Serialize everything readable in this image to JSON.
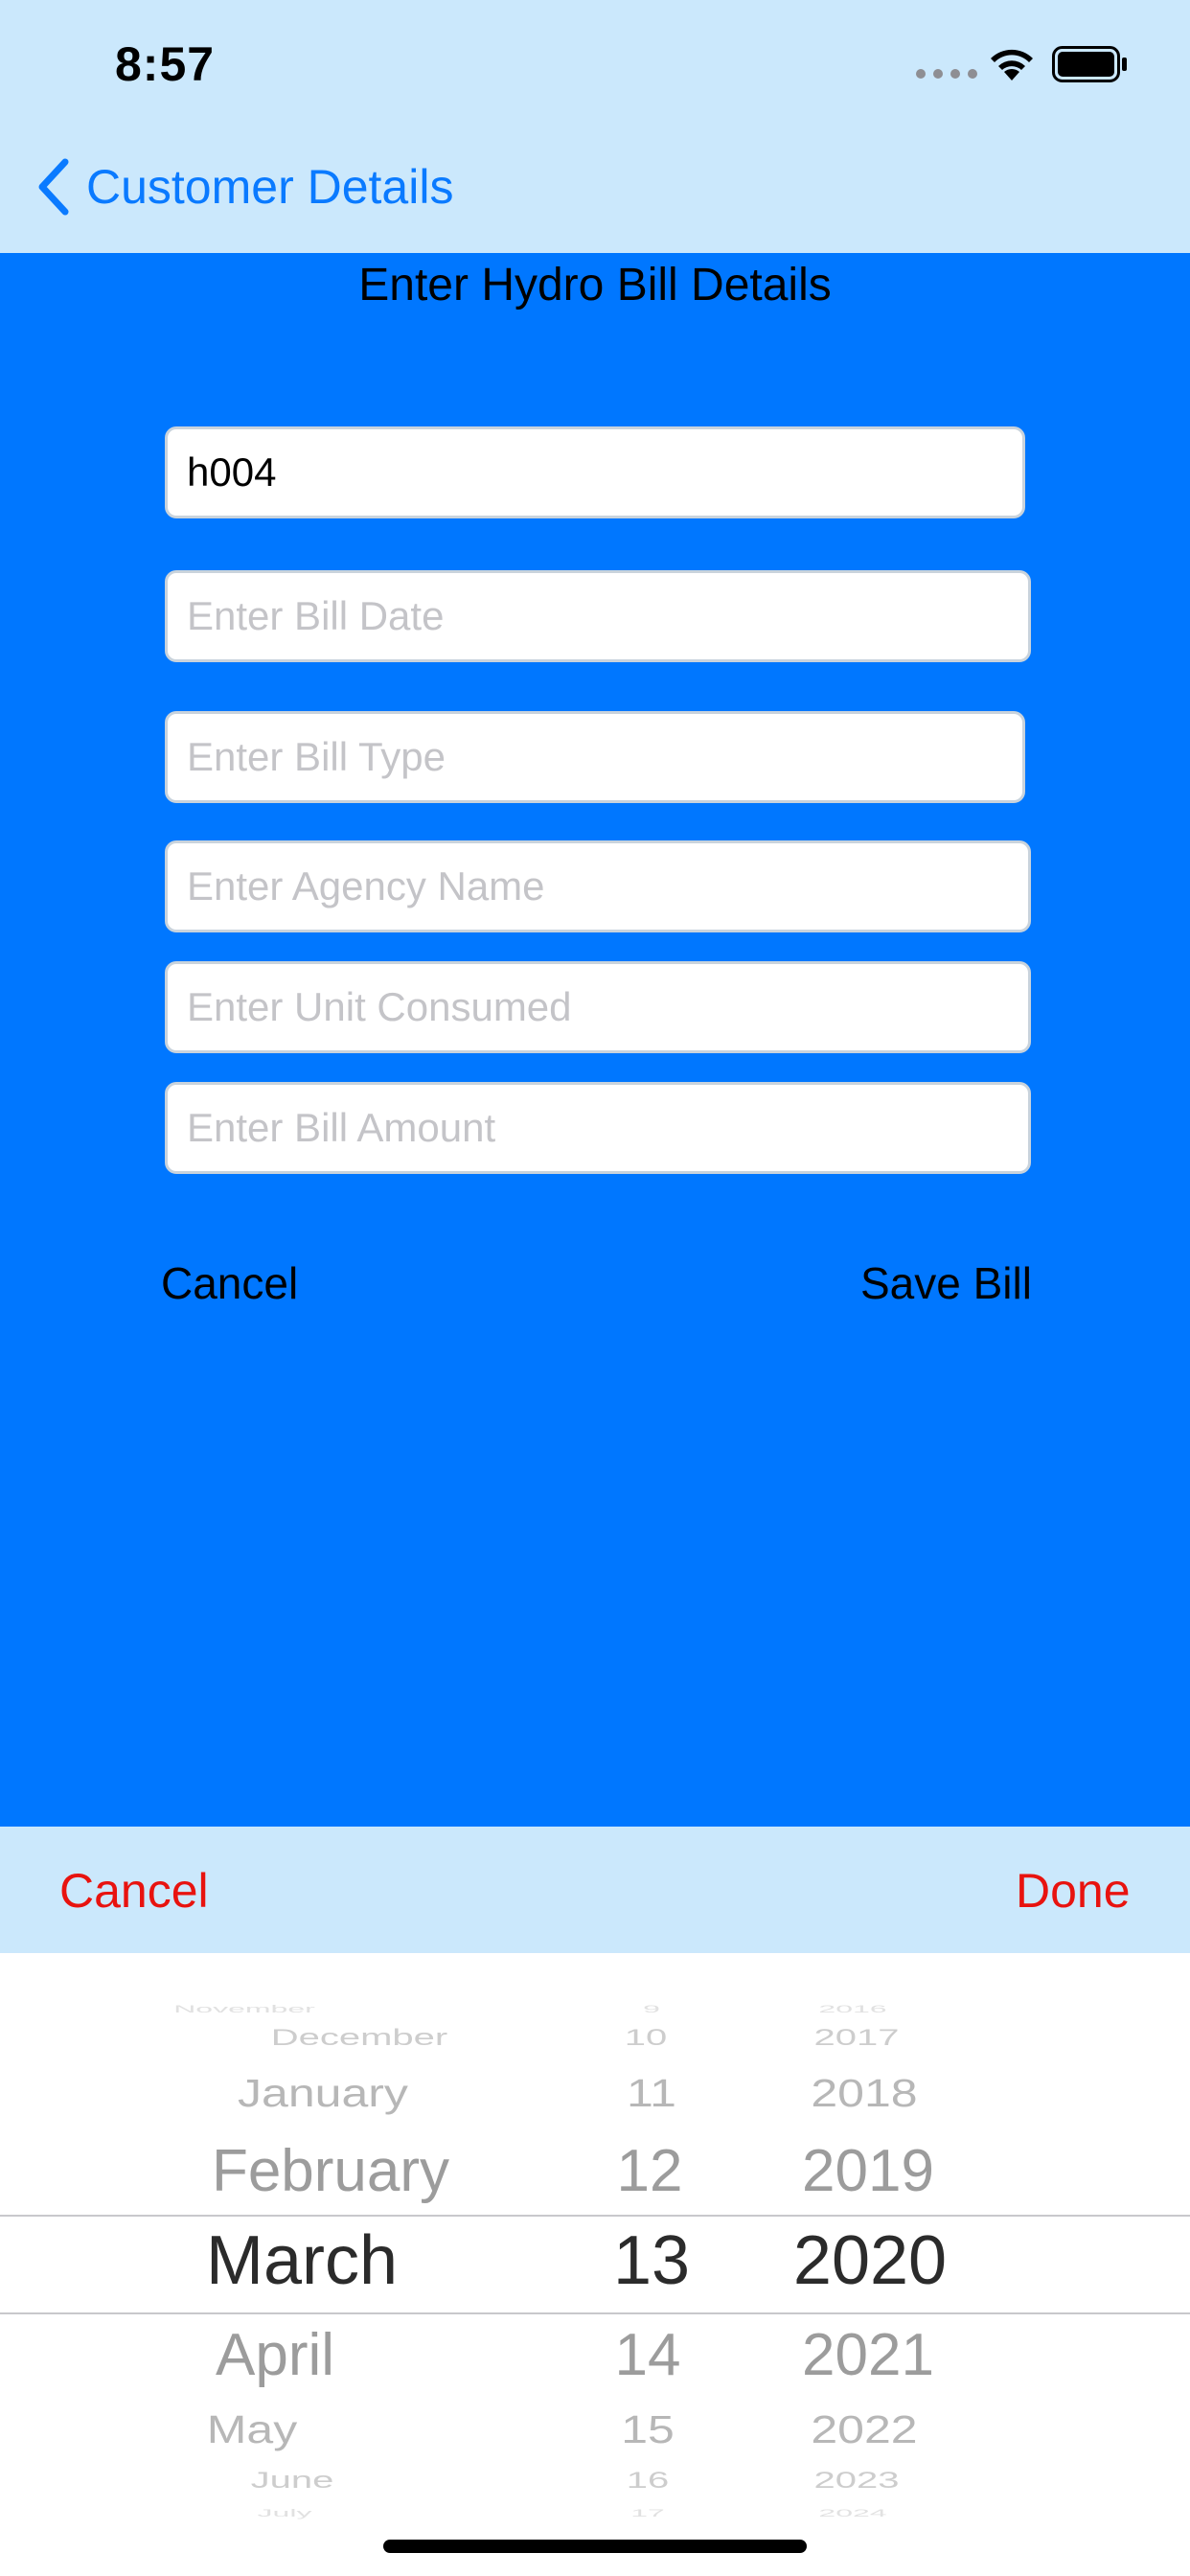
{
  "status_bar": {
    "time": "8:57"
  },
  "nav": {
    "back_label": "Customer Details"
  },
  "form": {
    "title": "Enter Hydro Bill Details",
    "bill_id_value": "h004",
    "bill_date_placeholder": "Enter Bill Date",
    "bill_type_placeholder": "Enter Bill Type",
    "agency_name_placeholder": "Enter Agency Name",
    "unit_consumed_placeholder": "Enter Unit Consumed",
    "bill_amount_placeholder": "Enter Bill Amount",
    "cancel_label": "Cancel",
    "save_label": "Save Bill"
  },
  "picker_toolbar": {
    "cancel_label": "Cancel",
    "done_label": "Done"
  },
  "date_picker": {
    "months": [
      "November",
      "December",
      "January",
      "February",
      "March",
      "April",
      "May",
      "June",
      "July"
    ],
    "days": [
      "9",
      "10",
      "11",
      "12",
      "13",
      "14",
      "15",
      "16",
      "17"
    ],
    "years": [
      "2016",
      "2017",
      "2018",
      "2019",
      "2020",
      "2021",
      "2022",
      "2023",
      "2024"
    ],
    "selected_month": "March",
    "selected_day": "13",
    "selected_year": "2020"
  },
  "colors": {
    "form_background": "#0077ff",
    "bar_background": "#cbe8fc",
    "accent_blue": "#0a7aff",
    "toolbar_red": "#e8130f"
  }
}
